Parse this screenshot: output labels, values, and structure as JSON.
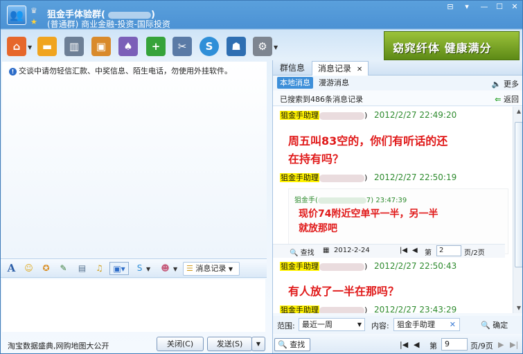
{
  "window": {
    "title": "狙金手体验群(",
    "title_close": ")",
    "subtitle": "(普通群) 商业金融-投资-国际投资",
    "controls": [
      "⊟",
      "▾",
      "—",
      "☐",
      "✕"
    ]
  },
  "toolbar": {
    "icons": [
      "home-icon",
      "folder-icon",
      "film-icon",
      "app-window-icon",
      "palette-icon",
      "plus-icon",
      "tools-icon",
      "soso-icon",
      "profile-icon",
      "settings-icon"
    ]
  },
  "banner": {
    "text": "窈窕纤体 健康满分"
  },
  "notice": {
    "text": "交谈中请勿轻信汇款、中奖信息、陌生电话，勿使用外挂软件。"
  },
  "format_toolbar": {
    "font_glyph": "A",
    "message_history_label": "消息记录"
  },
  "bottom": {
    "ad_text": "淘宝数据盛典,网购地图大公开",
    "close_button": "关闭(C)",
    "send_button": "发送(S)"
  },
  "right_tabs": {
    "group_info": "群信息",
    "message_history": "消息记录",
    "close": "✕"
  },
  "sub_tabs": {
    "local": "本地消息",
    "roaming": "漫游消息",
    "more": "更多"
  },
  "search_summary": {
    "text": "已搜索到486条消息记录",
    "back": "返回"
  },
  "messages": [
    {
      "sender": "狙金手助理",
      "sender_close": ")",
      "time": "2012/2/27 22:49:20",
      "text_lines": [
        "周五叫83空的，你们有听话的还",
        "在持有吗？"
      ]
    },
    {
      "sender": "狙金手助理",
      "sender_close": ")",
      "time": "2012/2/27 22:50:19",
      "quote": {
        "sender": "狙金手(",
        "sender_tail": "7) 23:47:39",
        "text_lines": [
          "现价74附近空单平一半，另一半",
          "就放那吧"
        ],
        "bar": {
          "find": "查找",
          "date": "2012-2-24",
          "page_label": "第",
          "page": "2",
          "page_total": "页/2页"
        }
      }
    },
    {
      "sender": "狙金手助理",
      "sender_close": ")",
      "time": "2012/2/27 22:50:43",
      "text_lines": [
        "有人放了一半在那吗？"
      ]
    },
    {
      "sender": "狙金手助理",
      "sender_close": ")",
      "time": "2012/2/27 23:43:29"
    }
  ],
  "filter": {
    "range_label": "范围:",
    "range_value": "最近一周",
    "content_label": "内容:",
    "content_value": "狙金手助理",
    "ok": "确定"
  },
  "pagination": {
    "find": "查找",
    "page_label": "第",
    "page": "9",
    "page_total": "页/9页"
  }
}
